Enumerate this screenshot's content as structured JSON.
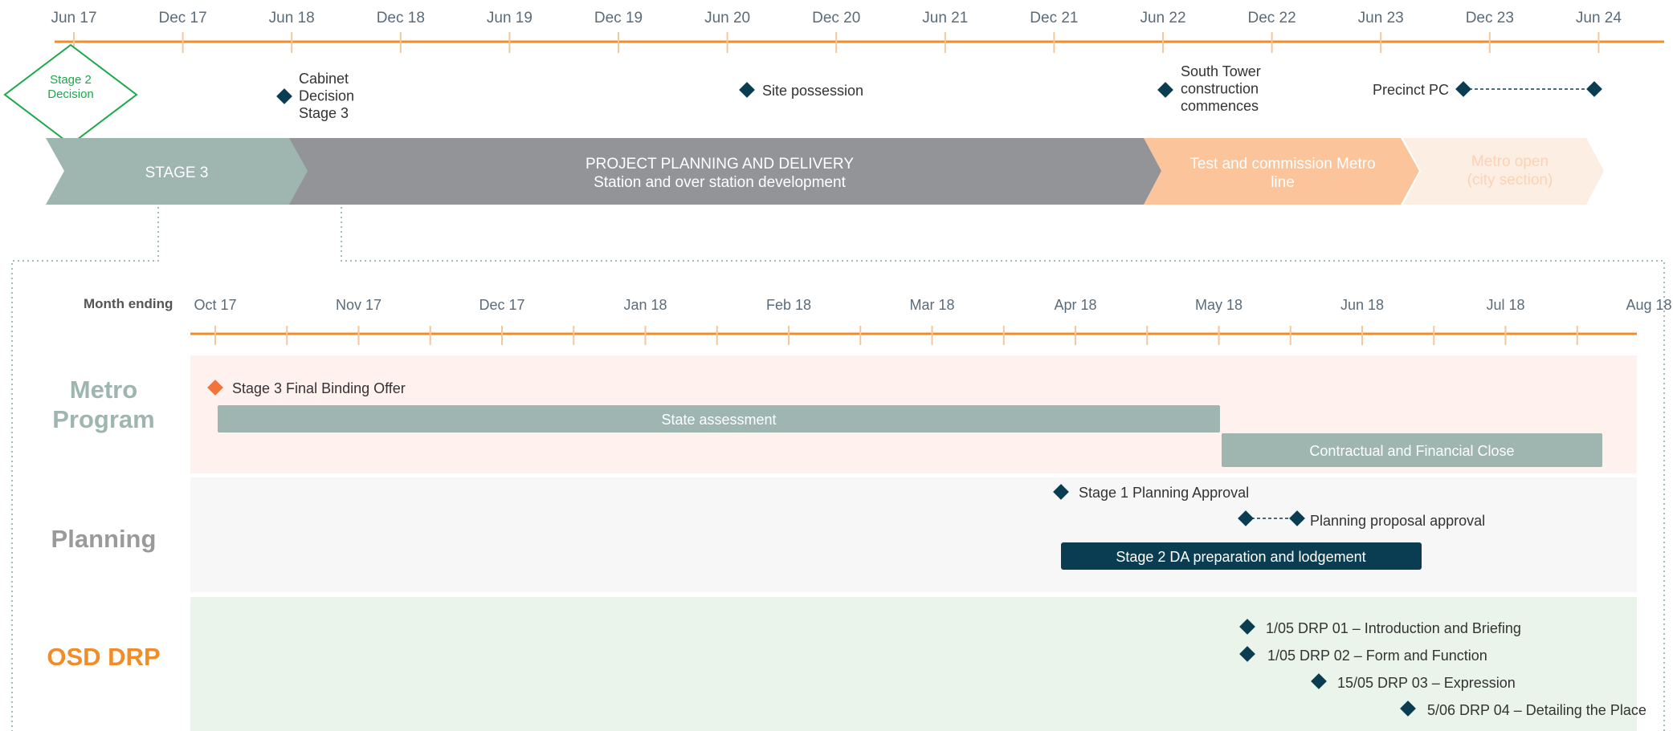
{
  "colors": {
    "timeline": "#F28C28",
    "tick": "#F5C79A",
    "axis_text": "#5A6B7A",
    "milestone": "#0B3D52",
    "stage2": "#1BA84A",
    "stage3_phase": "#9EB5B0",
    "delivery_phase": "#939498",
    "test_phase": "#FCC49A",
    "open_phase": "#FDEEE4",
    "open_text": "#FBD2B3",
    "metro_band": "#FFF2EE",
    "planning_band": "#F7F7F7",
    "osd_band": "#EBF4EA",
    "metro_title": "#9EB5B0",
    "planning_title": "#9A9A9A",
    "osd_title": "#F28C28",
    "offer_marker": "#F2743A",
    "label_text": "#333333",
    "dotted": "#7FA9A0"
  },
  "overview": {
    "ticks": [
      "Jun 17",
      "Dec 17",
      "Jun 18",
      "Dec 18",
      "Jun 19",
      "Dec 19",
      "Jun 20",
      "Dec 20",
      "Jun 21",
      "Dec 21",
      "Jun 22",
      "Dec 22",
      "Jun 23",
      "Dec 23",
      "Jun 24"
    ],
    "milestones": {
      "stage2_label": "Stage 2\nDecision",
      "cabinet_label": "Cabinet\nDecision\nStage 3",
      "site_label": "Site possession",
      "south_tower_label": "South Tower\nconstruction\ncommences",
      "precinct_label": "Precinct PC"
    },
    "phases": {
      "stage3": "STAGE 3",
      "delivery": "PROJECT PLANNING AND DELIVERY\nStation and over station development",
      "test": "Test and commission Metro\nline",
      "open": "Metro open\n(city section)"
    }
  },
  "detail": {
    "axis_title": "Month ending",
    "months": [
      "Oct 17",
      "Nov 17",
      "Dec 17",
      "Jan 18",
      "Feb 18",
      "Mar 18",
      "Apr 18",
      "May 18",
      "Jun 18",
      "Jul 18",
      "Aug 18"
    ],
    "sections": {
      "metro": {
        "title": "Metro\nProgram",
        "offer": "Stage 3 Final Binding Offer",
        "state_assessment": "State assessment",
        "close": "Contractual and Financial Close"
      },
      "planning": {
        "title": "Planning",
        "stage1": "Stage 1 Planning Approval",
        "proposal": "Planning proposal approval",
        "stage2_da": "Stage 2 DA preparation and lodgement"
      },
      "osd": {
        "title": "OSD DRP",
        "drp01": "1/05  DRP 01 – Introduction and Briefing",
        "drp02": "1/05 DRP 02 – Form and Function",
        "drp03": "15/05 DRP 03 – Expression",
        "drp04": "5/06 DRP 04 – Detailing the Place"
      }
    }
  }
}
